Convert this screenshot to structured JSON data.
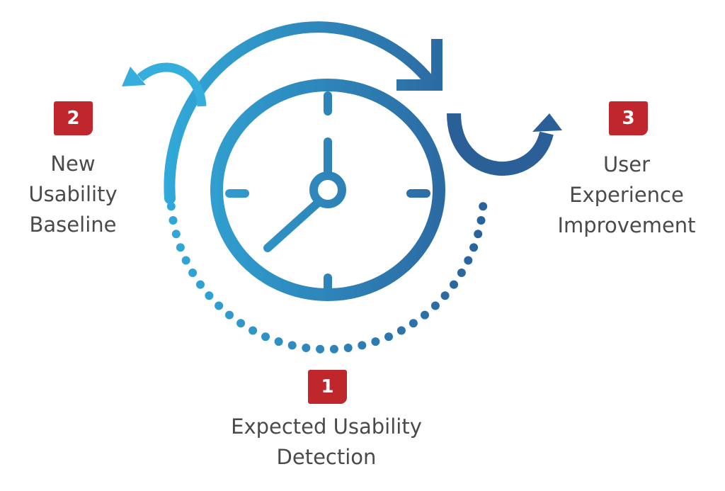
{
  "colors": {
    "gradient_start": "#32b3e2",
    "gradient_end": "#2a5f98",
    "badge": "#c0272d",
    "text": "#4a4a4a",
    "dark_arrow": "#2a5f98"
  },
  "steps": [
    {
      "number": "1",
      "lines": [
        "Expected Usability",
        "Detection"
      ]
    },
    {
      "number": "2",
      "lines": [
        "New",
        "Usability",
        "Baseline"
      ]
    },
    {
      "number": "3",
      "lines": [
        "User",
        "Experience",
        "Improvement"
      ]
    }
  ],
  "icons": [
    "clock-icon",
    "cycle-arrow-icon",
    "back-arrow-icon",
    "curved-up-arrow-icon"
  ]
}
